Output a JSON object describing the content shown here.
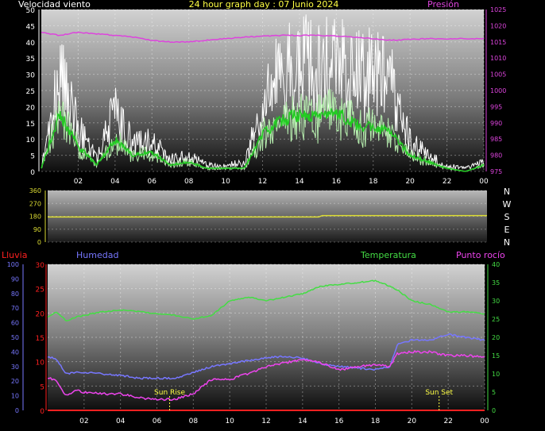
{
  "header": {
    "title": "24 hour graph day : 07 Junio 2024"
  },
  "colors": {
    "wind_gust": "#ffffff",
    "wind_avg": "#b8f0b0",
    "wind_avg_line": "#22cc22",
    "pressure": "#dd44dd",
    "direction": "#dddd33",
    "rain": "#ff2020",
    "humidity": "#7777ff",
    "temperature": "#44dd44",
    "dewpoint": "#ee44ee",
    "sun": "#ffff44",
    "axis_text": "#ffffff",
    "grid": "#ffffff"
  },
  "chart_data": [
    {
      "type": "line",
      "panel": "wind",
      "labels": {
        "left": "Velocidad viento",
        "right": "Presión"
      },
      "x_ticks": [
        "02",
        "04",
        "06",
        "08",
        "10",
        "12",
        "14",
        "16",
        "18",
        "20",
        "22",
        "00"
      ],
      "hours": [
        0,
        1,
        2,
        3,
        4,
        5,
        6,
        7,
        8,
        9,
        10,
        11,
        12,
        13,
        14,
        15,
        16,
        17,
        18,
        19,
        20,
        21,
        22,
        23,
        24
      ],
      "ylim_left": [
        0,
        50
      ],
      "yticks_left": [
        0,
        5,
        10,
        15,
        20,
        25,
        30,
        35,
        40,
        45,
        50
      ],
      "ylim_right": [
        975,
        1025
      ],
      "yticks_right": [
        975,
        980,
        985,
        990,
        995,
        1000,
        1005,
        1010,
        1015,
        1020,
        1025
      ],
      "series": [
        {
          "key": "gust",
          "axis": "left",
          "values": [
            2,
            32,
            14,
            4,
            20,
            9,
            10,
            4,
            5,
            2,
            2,
            3,
            20,
            34,
            36,
            34,
            36,
            32,
            32,
            28,
            10,
            5,
            2,
            1,
            3
          ]
        },
        {
          "key": "avg",
          "axis": "left",
          "values": [
            1,
            18,
            8,
            2,
            10,
            5,
            6,
            2,
            3,
            1,
            1,
            1,
            12,
            16,
            18,
            17,
            19,
            15,
            14,
            12,
            5,
            3,
            1,
            0,
            2
          ]
        },
        {
          "key": "pressure",
          "axis": "right",
          "values": [
            1018,
            1017,
            1018,
            1017.5,
            1017,
            1016.5,
            1015.5,
            1015,
            1015,
            1015.5,
            1016,
            1016.5,
            1016.8,
            1017,
            1017,
            1017,
            1016.8,
            1016.5,
            1016,
            1015.5,
            1015.8,
            1016,
            1016,
            1016,
            1016
          ]
        }
      ]
    },
    {
      "type": "line",
      "panel": "direction",
      "labels": {
        "compass": [
          "N",
          "W",
          "S",
          "E",
          "N"
        ]
      },
      "hours": [
        0,
        14.8,
        15,
        24
      ],
      "ylim": [
        0,
        360
      ],
      "yticks": [
        0,
        90,
        180,
        270,
        360
      ],
      "series": [
        {
          "key": "direction",
          "values": [
            175,
            175,
            185,
            185
          ]
        }
      ]
    },
    {
      "type": "line",
      "panel": "climate",
      "labels": {
        "rain": "Lluvia",
        "humidity": "Humedad",
        "temperature": "Temperatura",
        "dewpoint": "Punto rocío"
      },
      "x_ticks": [
        "02",
        "04",
        "06",
        "08",
        "10",
        "12",
        "14",
        "16",
        "18",
        "20",
        "22",
        "00"
      ],
      "hours": [
        0,
        0.5,
        1,
        1.5,
        2,
        3,
        4,
        5,
        6,
        7,
        8,
        9,
        10,
        11,
        12,
        13,
        14,
        15,
        16,
        17,
        18,
        18.8,
        19.2,
        20,
        21,
        22,
        23,
        24
      ],
      "ylim_humidity": [
        0,
        100
      ],
      "yticks_humidity": [
        0,
        10,
        20,
        30,
        40,
        50,
        60,
        70,
        80,
        90,
        100
      ],
      "ylim_rain": [
        0,
        30
      ],
      "yticks_rain": [
        0,
        5,
        10,
        15,
        20,
        25,
        30
      ],
      "ylim_temp": [
        0,
        40
      ],
      "yticks_temp": [
        0,
        5,
        10,
        15,
        20,
        25,
        30,
        35,
        40
      ],
      "series": [
        {
          "key": "temperature",
          "values": [
            25.5,
            27,
            24.5,
            25.5,
            26,
            27,
            27.5,
            27,
            26.5,
            26,
            25,
            26,
            30,
            31,
            30,
            31,
            32,
            34,
            34.5,
            35,
            35.5,
            34,
            33,
            30,
            29,
            27,
            27,
            26.5
          ]
        },
        {
          "key": "humidity",
          "values": [
            37,
            35,
            25,
            26,
            26,
            25,
            24,
            22,
            22,
            22,
            26,
            30,
            32,
            34,
            36,
            37,
            36,
            32,
            30,
            29,
            28,
            30,
            45,
            48,
            48,
            52,
            50,
            48
          ]
        },
        {
          "key": "dewpoint",
          "values": [
            9,
            8,
            4,
            5.5,
            5,
            4.5,
            4.5,
            3.5,
            3,
            3,
            4.5,
            8.5,
            8.5,
            10,
            12,
            13,
            14,
            13,
            11,
            12,
            12.5,
            12,
            15.5,
            16,
            16,
            15,
            15,
            14.5
          ]
        },
        {
          "key": "rain",
          "values": [
            0,
            0,
            0,
            0,
            0,
            0,
            0,
            0,
            0,
            0,
            0,
            0,
            0,
            0,
            0,
            0,
            0,
            0,
            0,
            0,
            0,
            0,
            0,
            0,
            0,
            0,
            0,
            0
          ]
        }
      ],
      "annotations": [
        {
          "label": "Sun Rise",
          "hour": 6.7
        },
        {
          "label": "Sun Set",
          "hour": 21.5
        }
      ]
    }
  ]
}
